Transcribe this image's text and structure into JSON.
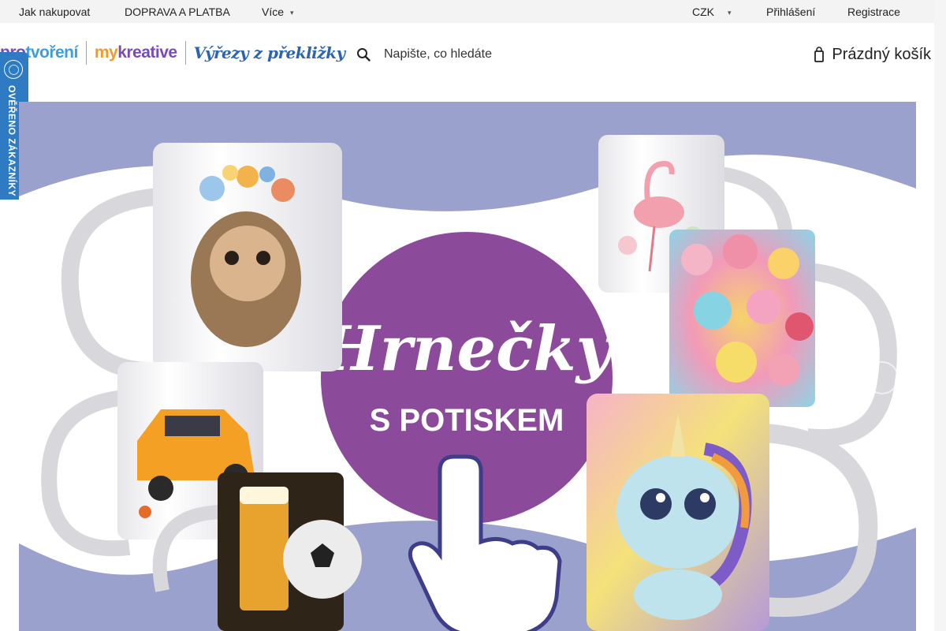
{
  "topbar": {
    "how_to_buy": "Jak nakupovat",
    "shipping": "DOPRAVA A PLATBA",
    "more": "Více",
    "currency": "CZK",
    "login": "Přihlášení",
    "register": "Registrace"
  },
  "header": {
    "logo_pro": "pro",
    "logo_tvoreni": "tvoření",
    "logo_my": "my",
    "logo_kreative": "kreative",
    "logo_vyrezy": "Výřezy z překližky",
    "search_placeholder": "Napište, co hledáte",
    "cart_label": "Prázdný košík"
  },
  "badge": {
    "text": "OVĚŘENO ZÁKAZNÍKY"
  },
  "banner": {
    "title": "Hrnečky",
    "subtitle": "S POTISKEM",
    "colors": {
      "background": "#9aa1cc",
      "circle": "#8b4a9a",
      "accent": "#2e7bc4"
    },
    "mugs": [
      "hedgehog-mug",
      "flamingo-mug",
      "hearts-mug",
      "car-mug",
      "beer-football-mug",
      "unicorn-mug"
    ]
  }
}
